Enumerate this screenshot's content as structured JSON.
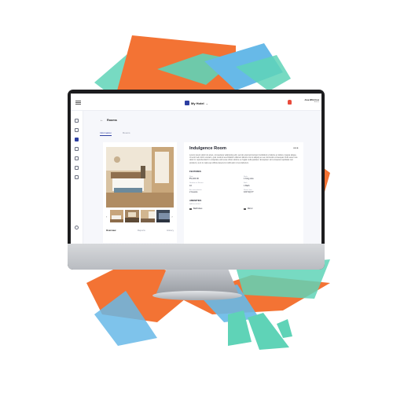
{
  "colors": {
    "accent": "#2d3fa1",
    "shape_orange": "#f37334",
    "shape_teal": "#5fd3b7",
    "shape_blue": "#67b9e8"
  },
  "topbar": {
    "hotel_name": "My Hotel",
    "user_name": "Jose Wild Cruz",
    "user_role": "Admin"
  },
  "sidebar": {
    "icons": [
      "dashboard-icon",
      "calendar-icon",
      "home-icon",
      "users-icon",
      "document-icon",
      "chart-icon",
      "tag-icon",
      "settings-icon"
    ]
  },
  "breadcrumb": {
    "label": "Rooms"
  },
  "tabs": [
    "Information",
    "Rooms"
  ],
  "room": {
    "title": "Indulgence Room",
    "description": "Lorem ipsum dolor sit amet, consectetur adipiscing elit, sed do eiusmod tempor incididunt ut labore et dolore magna aliqua. Ut enim ad minim veniam, quis nostrud exercitation ullamco laboris nisi ut aliquip ex ea commodo consequat. Duis aute irure dolor in reprehenderit in voluptate velit esse cillum dolore eu fugiat nulla pariatur. Excepteur sint occaecat cupidatat non proident, sunt in culpa qui officia deserunt mollit anim id est laborum.",
    "features_heading": "FEATURES",
    "features": [
      {
        "label": "Rate",
        "value": "₱1,400.00"
      },
      {
        "label": "Beds",
        "value": "1 King size"
      },
      {
        "label": "Number of Rooms",
        "value": "10"
      },
      {
        "label": "Bath",
        "value": "1 Bath"
      },
      {
        "label": "Accommodation",
        "value": "2 Guests"
      },
      {
        "label": "Room Size",
        "value": "100 SQ FT"
      }
    ],
    "amenities_heading": "AMENITIES",
    "amenities_sub": "BATH & BODY",
    "amenities": [
      "Bathrobes",
      "Mirror"
    ]
  },
  "gallery_tabs": [
    "Overview",
    "Reports",
    "History"
  ]
}
